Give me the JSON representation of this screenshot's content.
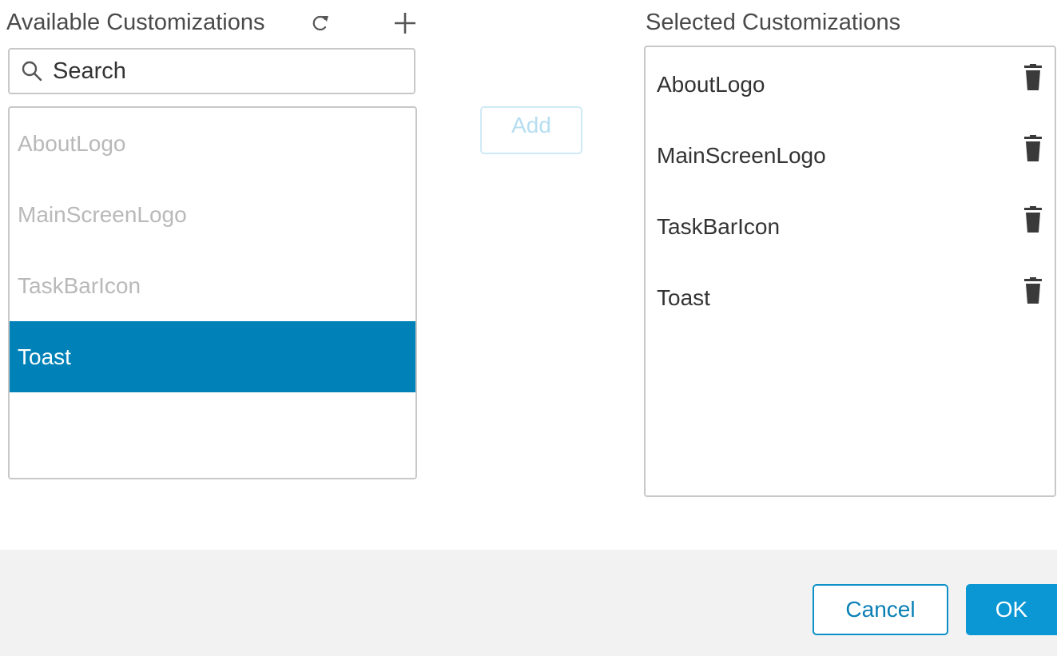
{
  "available": {
    "title": "Available Customizations",
    "refresh_icon": "refresh-icon",
    "add_icon": "plus-icon",
    "search": {
      "icon": "search-icon",
      "placeholder": "Search",
      "value": ""
    },
    "items": [
      {
        "label": "AboutLogo",
        "selected": false
      },
      {
        "label": "MainScreenLogo",
        "selected": false
      },
      {
        "label": "TaskBarIcon",
        "selected": false
      },
      {
        "label": "Toast",
        "selected": true
      }
    ]
  },
  "middle": {
    "add_label": "Add"
  },
  "selected": {
    "title": "Selected Customizations",
    "delete_icon": "trash-icon",
    "items": [
      {
        "label": "AboutLogo"
      },
      {
        "label": "MainScreenLogo"
      },
      {
        "label": "TaskBarIcon"
      },
      {
        "label": "Toast"
      }
    ]
  },
  "footer": {
    "cancel_label": "Cancel",
    "ok_label": "OK"
  },
  "colors": {
    "selection_bg": "#0082b8",
    "primary_button": "#0b97d3",
    "cancel_border": "#0d8fc7",
    "footer_bg": "#f2f2f2",
    "disabled_item_text": "#b9b9b9"
  }
}
